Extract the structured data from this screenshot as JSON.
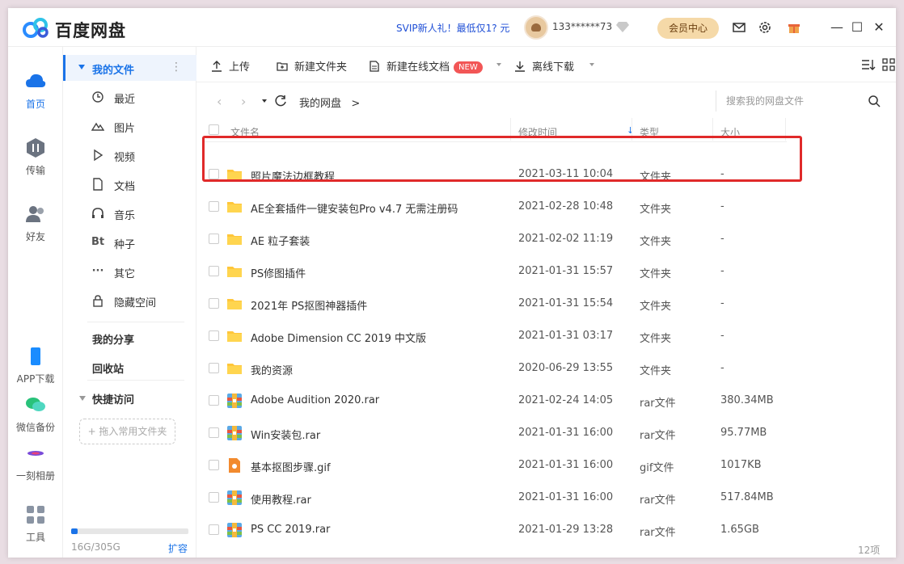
{
  "app": {
    "title": "百度网盘",
    "svip_promo": "SVIP新人礼！最低仅1? 元",
    "username": "133******73",
    "vip_center": "会员中心"
  },
  "rail": {
    "home": "首页",
    "transfer": "传输",
    "friends": "好友",
    "app_download": "APP下载",
    "wechat_backup": "微信备份",
    "album": "一刻相册",
    "tools": "工具"
  },
  "sidebar": {
    "my_files": "我的文件",
    "items": [
      {
        "label": "最近",
        "icon": "clock-icon"
      },
      {
        "label": "图片",
        "icon": "image-icon"
      },
      {
        "label": "视频",
        "icon": "video-icon"
      },
      {
        "label": "文档",
        "icon": "document-icon"
      },
      {
        "label": "音乐",
        "icon": "headphones-icon"
      },
      {
        "label": "种子",
        "icon": "torrent-icon"
      },
      {
        "label": "其它",
        "icon": "more-icon"
      },
      {
        "label": "隐藏空间",
        "icon": "lock-icon"
      }
    ],
    "my_share": "我的分享",
    "recycle": "回收站",
    "quick_access": "快捷访问",
    "drop_hint": "+ 拖入常用文件夹",
    "quota": "16G/305G",
    "quota_fraction": 0.052,
    "expand": "扩容"
  },
  "toolbar": {
    "upload": "上传",
    "new_folder": "新建文件夹",
    "new_online_doc": "新建在线文档",
    "new_badge": "NEW",
    "offline_download": "离线下载"
  },
  "nav": {
    "breadcrumb": "我的网盘",
    "breadcrumb_sep": ">",
    "search_placeholder": "搜索我的网盘文件"
  },
  "table": {
    "headers": {
      "name": "文件名",
      "modified": "修改时间",
      "type": "类型",
      "size": "大小"
    },
    "rows": [
      {
        "name": "照片魔法边框教程",
        "time": "2021-03-11 10:04",
        "type": "文件夹",
        "size": "-",
        "icon": "folder-icon"
      },
      {
        "name": "AE全套插件一键安装包Pro v4.7 无需注册码",
        "time": "2021-02-28 10:48",
        "type": "文件夹",
        "size": "-",
        "icon": "folder-icon"
      },
      {
        "name": "AE 粒子套装",
        "time": "2021-02-02 11:19",
        "type": "文件夹",
        "size": "-",
        "icon": "folder-icon"
      },
      {
        "name": "PS修图插件",
        "time": "2021-01-31 15:57",
        "type": "文件夹",
        "size": "-",
        "icon": "folder-icon"
      },
      {
        "name": "2021年 PS抠图神器插件",
        "time": "2021-01-31 15:54",
        "type": "文件夹",
        "size": "-",
        "icon": "folder-icon"
      },
      {
        "name": "Adobe Dimension CC 2019 中文版",
        "time": "2021-01-31 03:17",
        "type": "文件夹",
        "size": "-",
        "icon": "folder-icon"
      },
      {
        "name": "我的资源",
        "time": "2020-06-29 13:55",
        "type": "文件夹",
        "size": "-",
        "icon": "folder-icon"
      },
      {
        "name": "Adobe Audition 2020.rar",
        "time": "2021-02-24 14:05",
        "type": "rar文件",
        "size": "380.34MB",
        "icon": "rar-icon"
      },
      {
        "name": "Win安装包.rar",
        "time": "2021-01-31 16:00",
        "type": "rar文件",
        "size": "95.77MB",
        "icon": "rar-icon"
      },
      {
        "name": "基本抠图步骤.gif",
        "time": "2021-01-31 16:00",
        "type": "gif文件",
        "size": "1017KB",
        "icon": "gif-icon"
      },
      {
        "name": "使用教程.rar",
        "time": "2021-01-31 16:00",
        "type": "rar文件",
        "size": "517.84MB",
        "icon": "rar-icon"
      },
      {
        "name": "PS CC 2019.rar",
        "time": "2021-01-29 13:28",
        "type": "rar文件",
        "size": "1.65GB",
        "icon": "rar-icon"
      }
    ],
    "count": "12项"
  },
  "colors": {
    "accent": "#1a73e8",
    "highlight": "#e02a2a",
    "folder": "#ffc63a",
    "vip": "#f5d9a8"
  }
}
